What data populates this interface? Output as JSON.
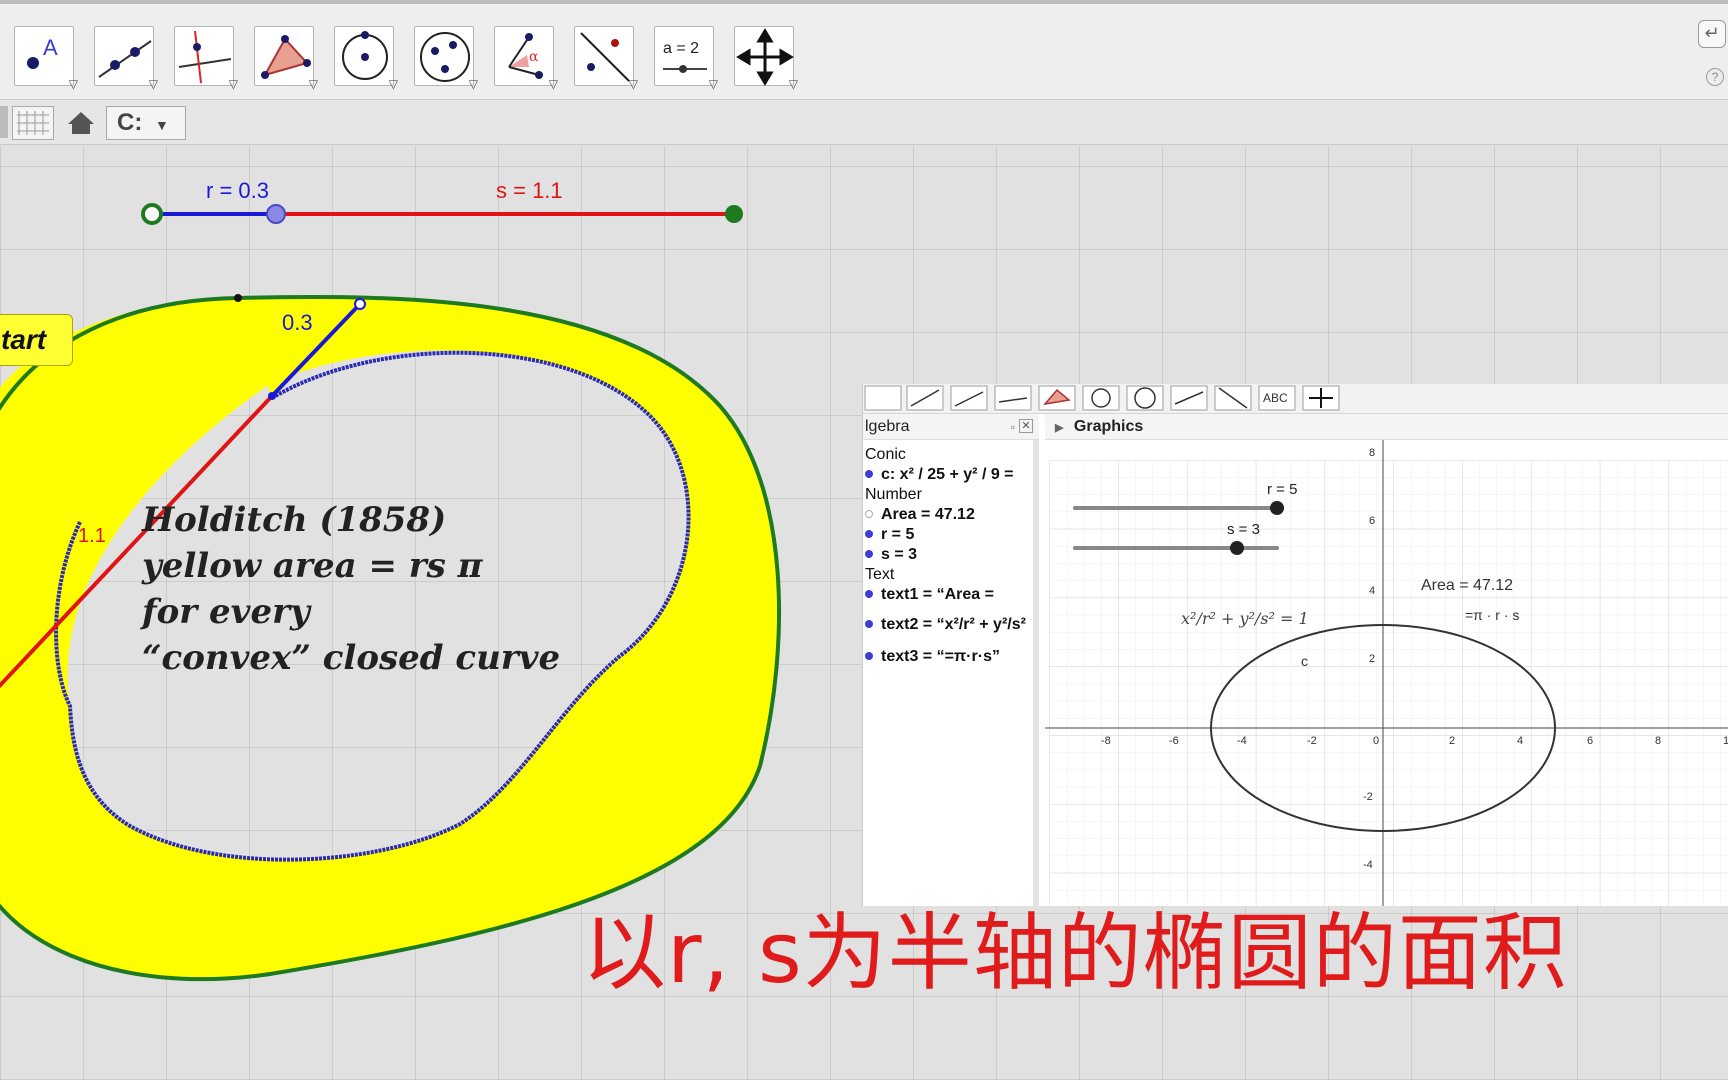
{
  "toolbar": {
    "tools": [
      {
        "name": "point-tool-icon"
      },
      {
        "name": "line-tool-icon"
      },
      {
        "name": "perpendicular-tool-icon"
      },
      {
        "name": "polygon-tool-icon"
      },
      {
        "name": "circle-tool-icon"
      },
      {
        "name": "conic-tool-icon"
      },
      {
        "name": "angle-tool-icon"
      },
      {
        "name": "reflect-tool-icon"
      },
      {
        "name": "slider-tool-icon",
        "label": "a = 2"
      },
      {
        "name": "move-graphics-tool-icon"
      }
    ],
    "undo_icon": "↵",
    "help_icon": "?"
  },
  "subbar": {
    "style_label": "C:"
  },
  "main": {
    "start_label": "tart",
    "slider_r_label": "r = 0.3",
    "slider_s_label": "s = 1.1",
    "seg_r_label": "0.3",
    "seg_s_label": "1.1",
    "note": {
      "line1": "Holditch (1858)",
      "line2": "yellow area = rs π",
      "line3": "for every",
      "line4": "“convex” closed curve"
    },
    "colors": {
      "yellow": "#ffff00",
      "green": "#1e7a1e",
      "blue": "#1a1ad6",
      "red": "#e01414"
    }
  },
  "inner_app": {
    "toolbar_text_tool": "ABC",
    "algebra": {
      "title": "lgebra",
      "groups": [
        {
          "label": "Conic",
          "items": [
            {
              "text": "c: x² / 25 + y² / 9 =",
              "filled": true
            }
          ]
        },
        {
          "label": "Number",
          "items": [
            {
              "text": "Area = 47.12",
              "filled": false
            },
            {
              "text": "r = 5",
              "filled": true
            },
            {
              "text": "s = 3",
              "filled": true
            }
          ]
        },
        {
          "label": "Text",
          "items": [
            {
              "text": "text1 = “Area =",
              "filled": true
            },
            {
              "text": "text2 = “x²/r² + y²/s²",
              "filled": true
            },
            {
              "text": "text3 = “=π·r·s”",
              "filled": true
            }
          ]
        }
      ]
    },
    "graphics": {
      "title": "Graphics",
      "slider_r": "r = 5",
      "slider_s": "s = 3",
      "slider_r_value": 5,
      "slider_s_value": 3,
      "area_text": "Area = 47.12",
      "formula_text": "=π · r · s",
      "equation": "x²/r² + y²/s² = 1",
      "conic_label": "c",
      "x_ticks": [
        "-8",
        "-6",
        "-4",
        "-2",
        "0",
        "2",
        "4",
        "6",
        "8",
        "1"
      ],
      "y_ticks": [
        "8",
        "6",
        "4",
        "2",
        "-2",
        "-4"
      ]
    }
  },
  "caption": "以r, s为半轴的椭圆的面积"
}
